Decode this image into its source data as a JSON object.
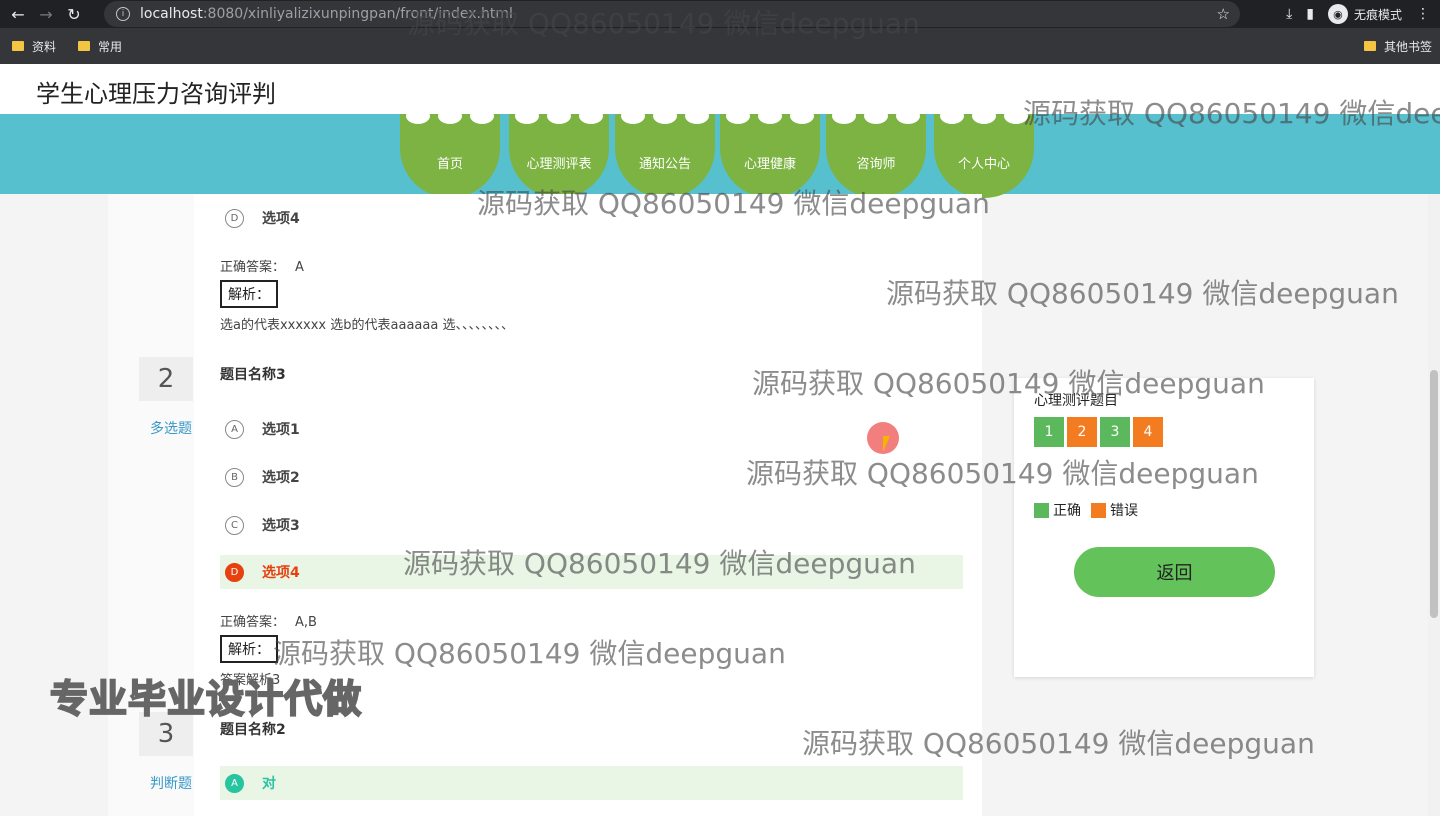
{
  "browser": {
    "url_host": "localhost",
    "url_path": ":8080/xinliyalizixunpingpan/front/index.html",
    "incognito_label": "无痕模式",
    "bookmarks": [
      "资料",
      "常用"
    ],
    "other_bookmarks": "其他书签"
  },
  "site": {
    "title": "学生心理压力咨询评判",
    "nav": [
      "首页",
      "心理测评表",
      "通知公告",
      "心理健康",
      "咨询师",
      "个人中心"
    ],
    "nav_color": "#7cb342",
    "band_color": "#57c0cf"
  },
  "questions": [
    {
      "options": [
        {
          "letter": "D",
          "text": "选项4",
          "state": "none"
        }
      ],
      "answer_label": "正确答案：",
      "answer": "A",
      "analysis_label": "解析：",
      "analysis_text": "选a的代表xxxxxx 选b的代表aaaaaa 选、、、、、、、、"
    },
    {
      "number": "2",
      "type": "多选题",
      "title": "题目名称3",
      "options": [
        {
          "letter": "A",
          "text": "选项1",
          "state": "none"
        },
        {
          "letter": "B",
          "text": "选项2",
          "state": "none"
        },
        {
          "letter": "C",
          "text": "选项3",
          "state": "none"
        },
        {
          "letter": "D",
          "text": "选项4",
          "state": "wrong"
        }
      ],
      "answer_label": "正确答案：",
      "answer": "A,B",
      "analysis_label": "解析：",
      "analysis_text": "答案解析3"
    },
    {
      "number": "3",
      "type": "判断题",
      "title": "题目名称2",
      "options": [
        {
          "letter": "A",
          "text": "对",
          "state": "right"
        }
      ]
    }
  ],
  "sidebar": {
    "title": "心理测评题目",
    "numbers": [
      {
        "label": "1",
        "status": "correct"
      },
      {
        "label": "2",
        "status": "wrong"
      },
      {
        "label": "3",
        "status": "correct"
      },
      {
        "label": "4",
        "status": "wrong"
      }
    ],
    "legend_correct": "正确",
    "legend_wrong": "错误",
    "correct_color": "#5cb85c",
    "wrong_color": "#f47c20",
    "back_label": "返回"
  },
  "watermark_text": "源码获取 QQ86050149 微信deepguan",
  "ad_text": "专业毕业设计代做"
}
